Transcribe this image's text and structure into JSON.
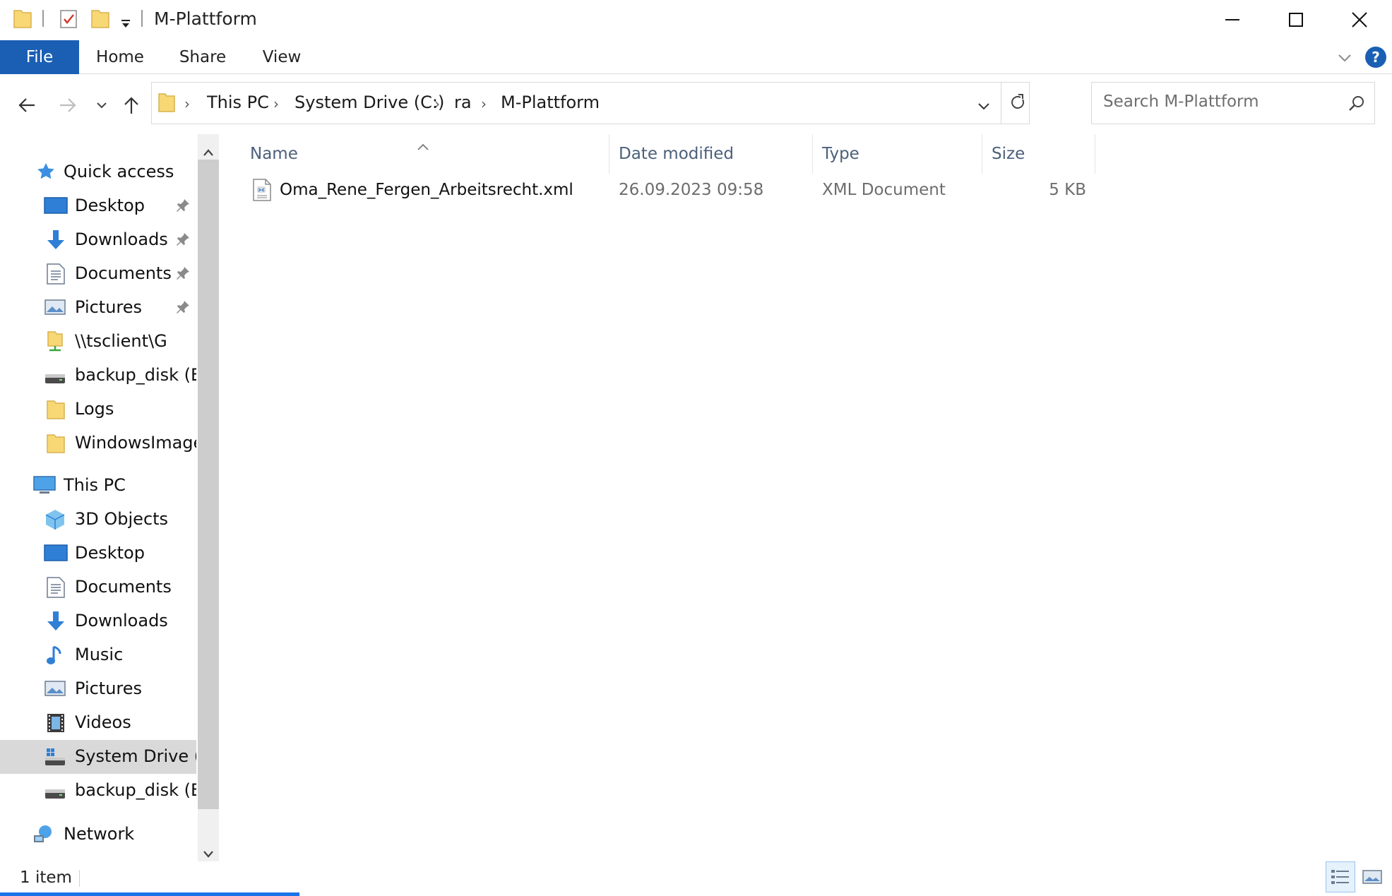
{
  "window": {
    "title": "M-Plattform",
    "minimize_icon": "minimize-icon",
    "maximize_icon": "maximize-icon",
    "close_icon": "close-icon"
  },
  "quick_access_toolbar": {
    "icons": [
      "folder-icon",
      "properties-icon",
      "new-folder-icon",
      "dropdown-arrow-icon"
    ]
  },
  "ribbon": {
    "tabs": [
      {
        "label": "File"
      },
      {
        "label": "Home"
      },
      {
        "label": "Share"
      },
      {
        "label": "View"
      }
    ],
    "expand_icon": "chevron-down-icon",
    "help_icon": "help-icon",
    "accent_color": "#1a5fb4"
  },
  "navigation": {
    "back_icon": "back-arrow-icon",
    "forward_icon": "forward-arrow-icon",
    "recent_icon": "chevron-down-icon",
    "up_icon": "up-arrow-icon",
    "breadcrumb": [
      "This PC",
      "System Drive (C:)",
      "ra",
      "M-Plattform"
    ],
    "refresh_icon": "refresh-icon",
    "search_placeholder": "Search M-Plattform"
  },
  "sidebar": {
    "groups": [
      {
        "label": "Quick access",
        "icon": "star-icon",
        "items": [
          {
            "label": "Desktop",
            "icon": "desktop-icon",
            "pinned": true
          },
          {
            "label": "Downloads",
            "icon": "download-icon",
            "pinned": true
          },
          {
            "label": "Documents",
            "icon": "document-icon",
            "pinned": true
          },
          {
            "label": "Pictures",
            "icon": "pictures-icon",
            "pinned": true
          },
          {
            "label": "\\\\tsclient\\G",
            "icon": "network-folder-icon",
            "pinned": false
          },
          {
            "label": "backup_disk (E:)",
            "icon": "drive-icon",
            "pinned": false
          },
          {
            "label": "Logs",
            "icon": "folder-icon",
            "pinned": false
          },
          {
            "label": "WindowsImageB",
            "icon": "folder-icon",
            "pinned": false
          }
        ]
      },
      {
        "label": "This PC",
        "icon": "computer-icon",
        "items": [
          {
            "label": "3D Objects",
            "icon": "cube-icon"
          },
          {
            "label": "Desktop",
            "icon": "desktop-icon"
          },
          {
            "label": "Documents",
            "icon": "document-icon"
          },
          {
            "label": "Downloads",
            "icon": "download-icon"
          },
          {
            "label": "Music",
            "icon": "music-icon"
          },
          {
            "label": "Pictures",
            "icon": "pictures-icon"
          },
          {
            "label": "Videos",
            "icon": "videos-icon"
          },
          {
            "label": "System Drive (C:",
            "icon": "system-drive-icon",
            "selected": true
          },
          {
            "label": "backup_disk (E:)",
            "icon": "drive-icon"
          }
        ]
      },
      {
        "label": "Network",
        "icon": "network-icon",
        "items": []
      }
    ]
  },
  "file_list": {
    "columns": [
      "Name",
      "Date modified",
      "Type",
      "Size"
    ],
    "sort_icon": "sort-ascending-icon",
    "rows": [
      {
        "name": "Oma_Rene_Fergen_Arbeitsrecht.xml",
        "date_modified": "26.09.2023 09:58",
        "type": "XML Document",
        "size": "5 KB",
        "icon": "xml-file-icon"
      }
    ]
  },
  "status_bar": {
    "item_count": "1 item",
    "view_icons": [
      "details-view-icon",
      "large-icons-view-icon"
    ]
  }
}
